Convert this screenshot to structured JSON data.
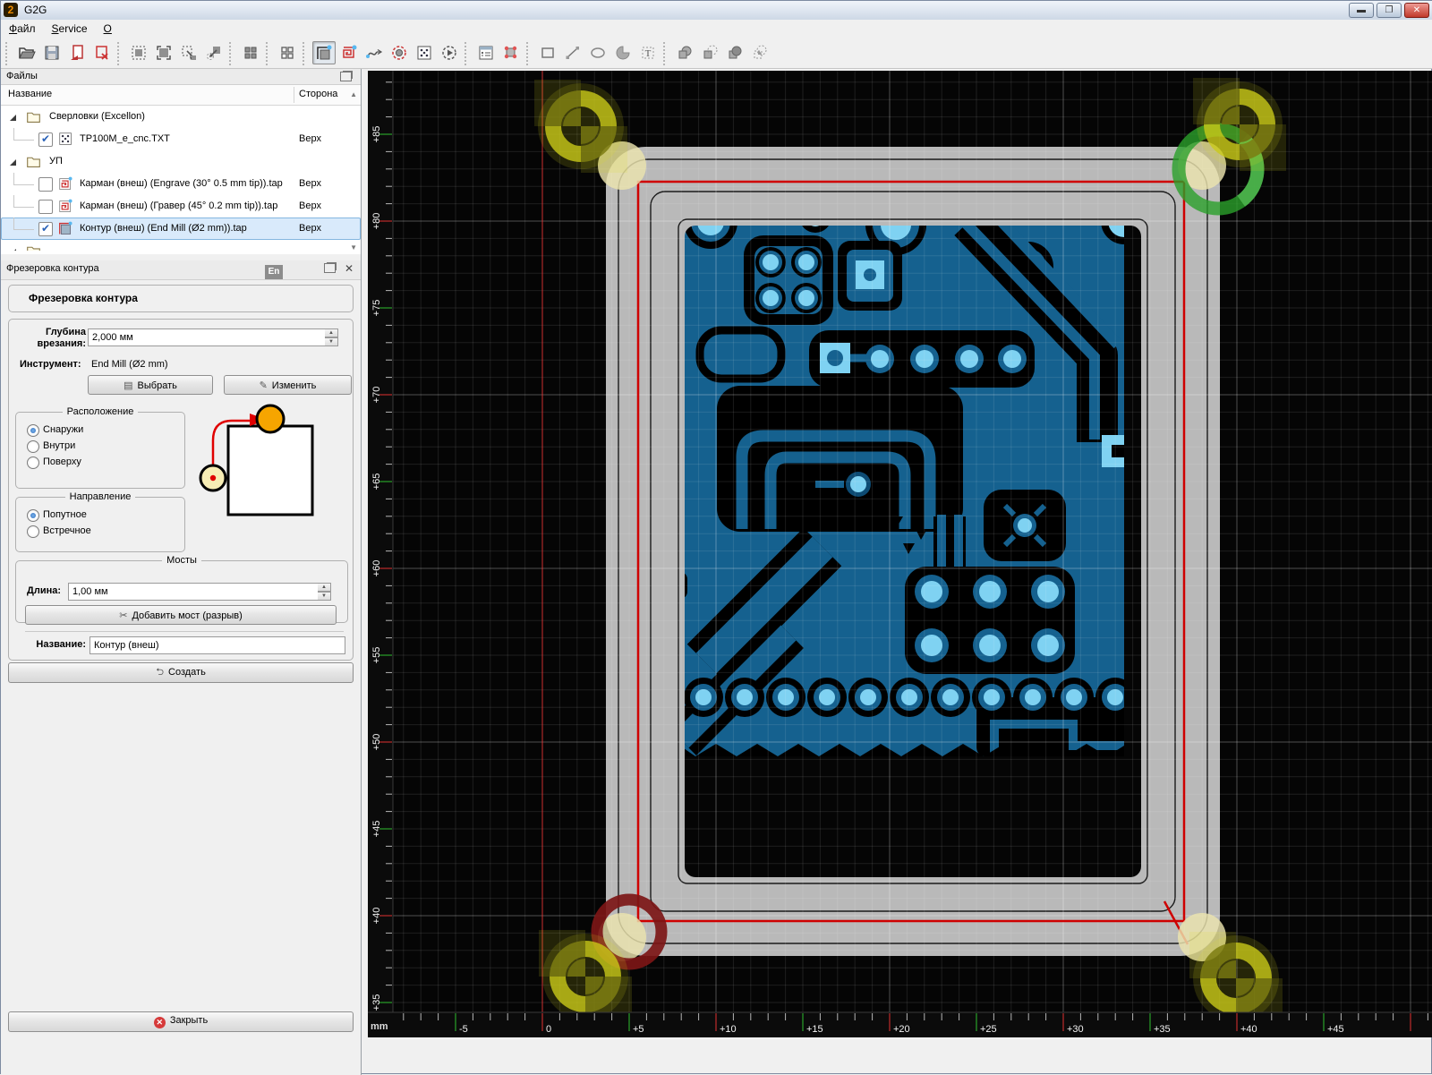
{
  "window": {
    "title": "G2G",
    "menus": [
      "Файл",
      "Service",
      "О"
    ]
  },
  "toolbar": {
    "pressed": "contour-mill-tool",
    "groups": [
      [
        "open-file",
        "save-file",
        "import-file",
        "remove-file"
      ],
      [
        "select-area",
        "fit-board",
        "zoom-to-selection",
        "zoom-out-selection"
      ],
      [
        "panelize"
      ],
      [
        "panelize-outline"
      ],
      [
        "contour-mill-tool",
        "pocket-mill-tool",
        "path-tool",
        "drill-tool",
        "drill-array-tool",
        "run-program-tool"
      ],
      [
        "program-form",
        "transform-tool"
      ],
      [
        "draw-rectangle",
        "draw-line",
        "draw-ellipse",
        "draw-arc",
        "draw-text"
      ],
      [
        "bool-union",
        "bool-subtract",
        "bool-intersect",
        "bool-exclude"
      ]
    ]
  },
  "files_panel": {
    "title": "Файлы",
    "columns": [
      "Название",
      "Сторона"
    ],
    "tree": [
      {
        "type": "folder",
        "label": "Сверловки (Excellon)"
      },
      {
        "type": "drill",
        "label": "TP100M_e_cnc.TXT",
        "side": "Верх",
        "checked": true
      },
      {
        "type": "folder",
        "label": "УП"
      },
      {
        "type": "pocket",
        "label": "Карман (внеш) (Engrave (30° 0.5 mm tip)).tap",
        "side": "Верх",
        "checked": false
      },
      {
        "type": "pocket",
        "label": "Карман (внеш) (Гравер (45° 0.2 mm tip)).tap",
        "side": "Верх",
        "checked": false
      },
      {
        "type": "contour",
        "label": "Контур (внеш) (End Mill (Ø2 mm)).tap",
        "side": "Верх",
        "checked": true,
        "selected": true
      }
    ]
  },
  "contour_panel": {
    "title": "Фрезеровка контура",
    "lang_badge": "En",
    "heading": "Фрезеровка контура",
    "depth_label": "Глубина врезания:",
    "depth_value": "2,000 мм",
    "tool_label": "Инструмент:",
    "tool_value": "End Mill (Ø2 mm)",
    "select_button": "Выбрать",
    "edit_button": "Изменить",
    "placement": {
      "title": "Расположение",
      "options": [
        "Снаружи",
        "Внутри",
        "Поверху"
      ],
      "selected": "Снаружи"
    },
    "direction": {
      "title": "Направление",
      "options": [
        "Попутное",
        "Встречное"
      ],
      "selected": "Попутное"
    },
    "bridges": {
      "title": "Мосты",
      "length_label": "Длина:",
      "length_value": "1,00 мм",
      "add_button": "Добавить мост (разрыв)"
    },
    "name_label": "Название:",
    "name_value": "Контур (внеш)",
    "create_button": "Создать",
    "close_button": "Закрыть"
  },
  "canvas": {
    "unit_label": "mm",
    "x_tick_labels": [
      "-5",
      "0",
      "+5",
      "+10",
      "+15",
      "+20",
      "+25",
      "+30",
      "+35",
      "+40",
      "+45"
    ],
    "y_tick_labels": [
      "+85",
      "+80",
      "+75",
      "+70",
      "+65",
      "+60",
      "+55",
      "+50",
      "+45",
      "+40",
      "+35"
    ]
  },
  "theme": {
    "copper": "#15618f",
    "pad_light": "#7fd2f2",
    "contour_red": "#cf0000",
    "mill_swath_gray": "#b9b9b9",
    "mark_yellow": "#c9c919",
    "mark_green": "#2aa02a",
    "mark_maroon": "#7c1616",
    "selection_blue": "#d9eafb"
  }
}
